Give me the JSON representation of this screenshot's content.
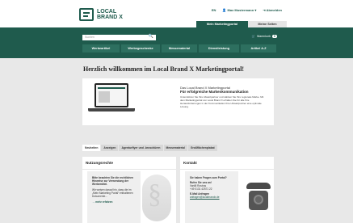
{
  "brand": {
    "line1": "LOCAL",
    "line2": "BRAND X"
  },
  "toplinks": [
    "EN",
    "Max Mustermann",
    "Abmelden"
  ],
  "header_tabs": [
    "Mein Marketingportal",
    "Meine Seiten"
  ],
  "search": {
    "placeholder": "Suchen"
  },
  "cart": {
    "label": "Warenkorb",
    "count": "0"
  },
  "nav": [
    "Werbeartikel",
    "Werbegeschenke",
    "Messematerial",
    "Dienstleistung",
    "Artikel A-Z"
  ],
  "page_title": "Herzlich willkommen im Local Brand X Marketingportal!",
  "hero": {
    "subtitle": "Das Local Brand X Marketingportal",
    "headline": "Für erfolgreiche Markenkommunikation",
    "description": "Unterstützen Sie Ihre Absatzpartner und stärken Sie Ihre regionale Marke. Mit dem Marketingportal von Local Brand X erhalten Sie für alle Ihre Herausforderungen in der Kommunikation Ihrer Absatzpartner eine optimale Lösung."
  },
  "tabs": [
    "Neuheiten",
    "Anzeigen",
    "Agenturflyer und -broschüren",
    "Messematerial",
    "Großflächenplakat"
  ],
  "panels": {
    "left": {
      "title": "Nutzungsrechte",
      "bold": "Bitte beachten Sie die rechtlichen Hinweise zur Verwendung der Werbemittel.",
      "body": "Wir weisen darauf hin, dass die im „Mein Marketing Portal“ enthaltenen Dokumente...",
      "link": "→ mehr erfahren"
    },
    "right": {
      "title": "Kontakt",
      "bold": "Sie haben Fragen zum Portal?",
      "line1": "Rufen Sie uns an!",
      "line2": "Vanilli Rostrus",
      "line3": "+49 0131 42571 22",
      "label": "E-Mail Anfragen",
      "email": "anfragen@localbrandx.de"
    }
  },
  "colors": {
    "brand": "#1f5b4d",
    "bg": "#e8e8e8"
  }
}
